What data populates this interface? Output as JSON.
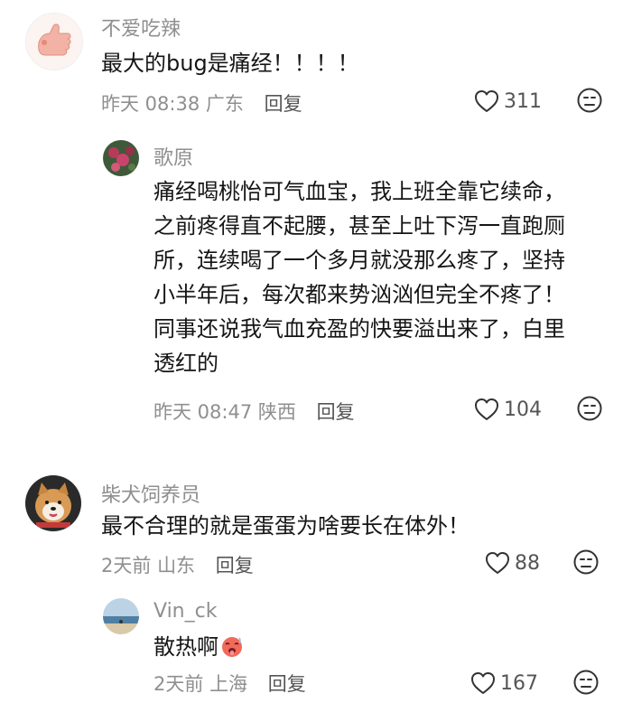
{
  "comments": [
    {
      "username": "不爱吃辣",
      "content": [
        "最大的bug是痛经！！！！"
      ],
      "time": "昨天 08:38",
      "location": "广东",
      "reply_label": "回复",
      "likes": "311",
      "replies": [
        {
          "username": "歌原",
          "content": [
            "痛经喝桃怡可气血宝，我上班全靠它续命，",
            "之前疼得直不起腰，甚至上吐下泻一直跑厕",
            "所，连续喝了一个多月就没那么疼了，坚持",
            "小半年后，每次都来势汹汹但完全不疼了！",
            "同事还说我气血充盈的快要溢出来了，白里",
            "透红的"
          ],
          "time": "昨天 08:47",
          "location": "陕西",
          "reply_label": "回复",
          "likes": "104"
        }
      ]
    },
    {
      "username": "柴犬饲养员",
      "content": [
        "最不合理的就是蛋蛋为啥要长在体外！"
      ],
      "time": "2天前",
      "location": "山东",
      "reply_label": "回复",
      "likes": "88",
      "replies": [
        {
          "username": "Vin_ck",
          "content": [
            "散热啊"
          ],
          "content_emoji": "hot-face-emoji",
          "time": "2天前",
          "location": "上海",
          "reply_label": "回复",
          "likes": "167"
        }
      ]
    }
  ],
  "icons": {
    "like": "heart-outline-icon",
    "dislike": "unamused-face-icon"
  },
  "colors": {
    "meta_text": "#8f8f8f",
    "body_text": "#151515",
    "reply_text": "#555555"
  }
}
